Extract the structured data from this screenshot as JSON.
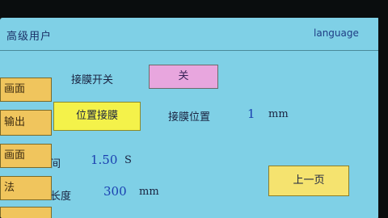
{
  "header": {
    "title": "高级用户",
    "language_label": "language"
  },
  "film_switch": {
    "label": "接膜开关",
    "button": "关"
  },
  "position_film": {
    "button": "位置接膜",
    "label": "接膜位置",
    "value": "1",
    "unit": "mm"
  },
  "time_row": {
    "label": "间",
    "value": "1.50",
    "unit": "S"
  },
  "length_row": {
    "label": "长度",
    "value": "300",
    "unit": "mm"
  },
  "prev_page": {
    "label": "上一页"
  },
  "side_menu": [
    "画面",
    "输出",
    "画面",
    "法",
    ""
  ]
}
